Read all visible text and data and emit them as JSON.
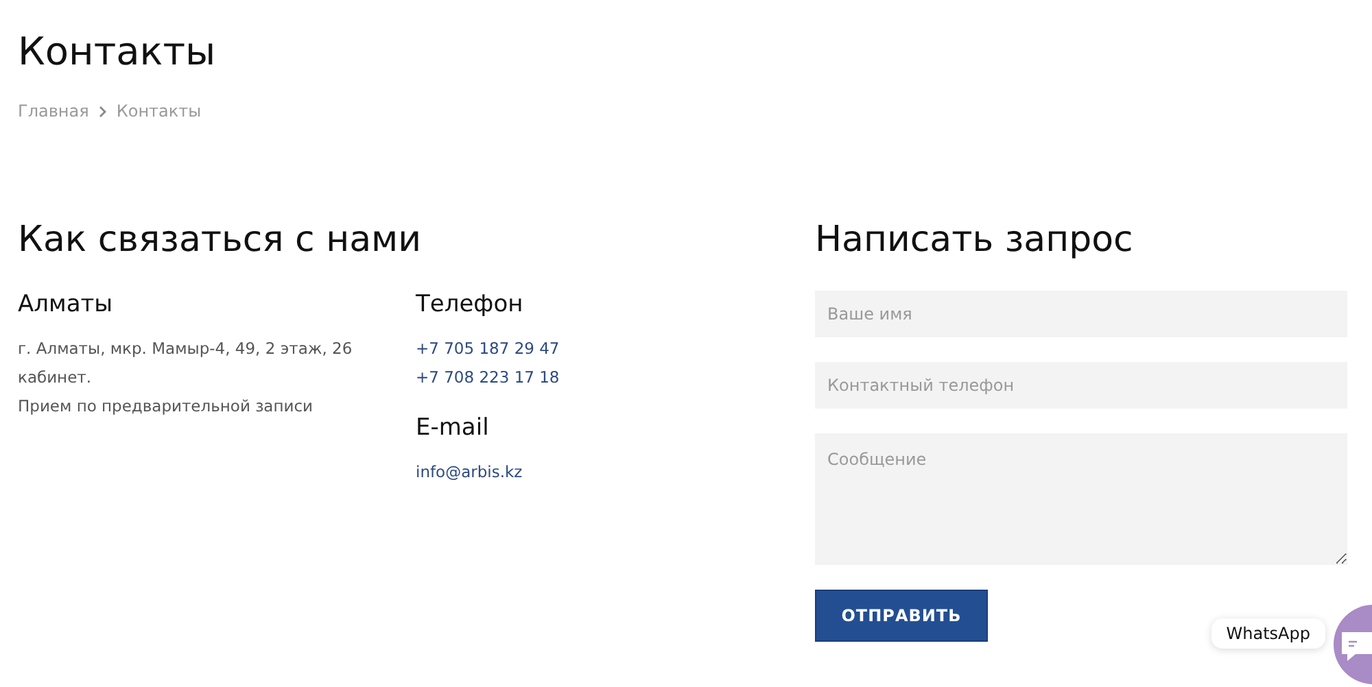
{
  "page_title": "Контакты",
  "breadcrumbs": [
    {
      "label": "Главная"
    },
    {
      "label": "Контакты"
    }
  ],
  "contacts": {
    "heading": "Как связаться с нами",
    "city": {
      "title": "Алматы",
      "lines": [
        "г. Алматы, мкр. Мамыр-4, 49, 2 этаж, 26 кабинет.",
        "Прием по предварительной записи"
      ]
    },
    "phone": {
      "title": "Телефон",
      "numbers": [
        "+7 705 187 29 47",
        "+7 708 223 17 18"
      ]
    },
    "email": {
      "title": "E-mail",
      "address": "info@arbis.kz"
    }
  },
  "form": {
    "heading": "Написать запрос",
    "fields": [
      {
        "kind": "input",
        "placeholder": "Ваше имя"
      },
      {
        "kind": "input",
        "placeholder": "Контактный телефон"
      },
      {
        "kind": "textarea",
        "placeholder": "Сообщение"
      }
    ],
    "submit": "ОТПРАВИТЬ"
  },
  "chat_widget": {
    "label": "WhatsApp"
  }
}
